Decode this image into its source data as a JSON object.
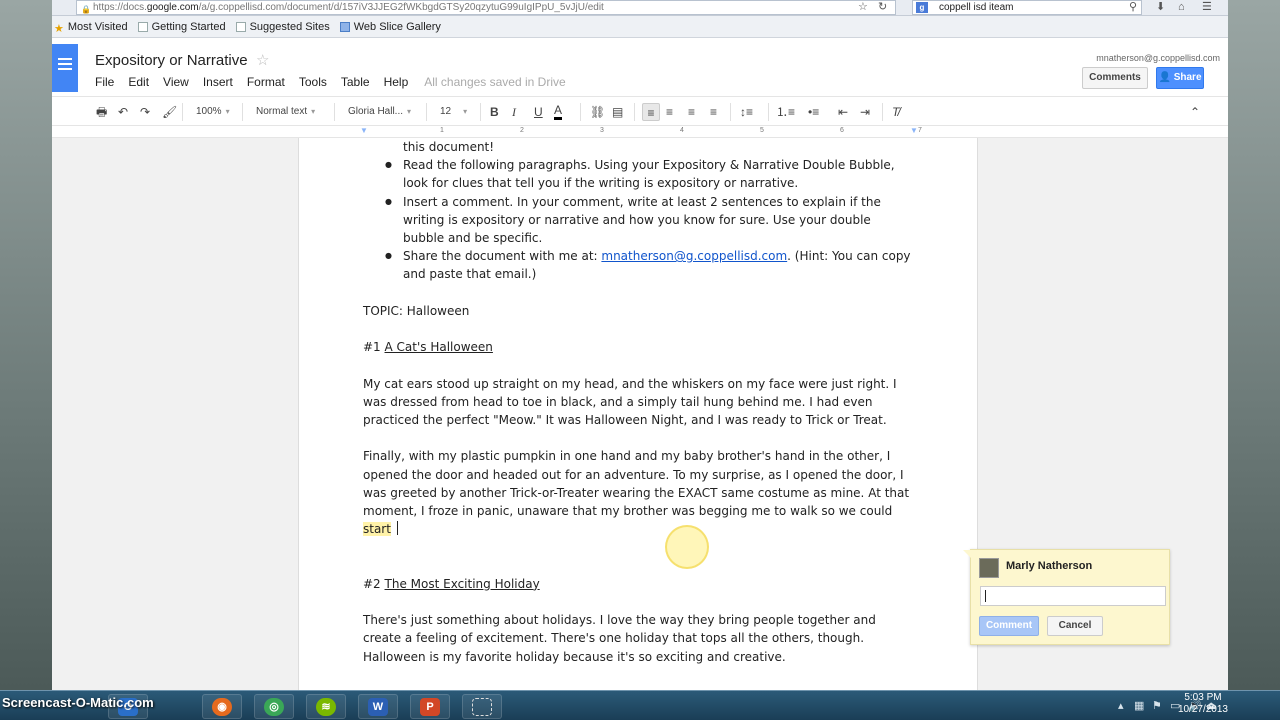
{
  "browser": {
    "url_prefix": "https://docs.",
    "url_domain": "google.com",
    "url_rest": "/a/g.coppellisd.com/document/d/157iV3JJEG2fWKbgdGTSy20qzytuG99uIgIPpU_5vJjU/edit",
    "search_query": "coppell isd iteam",
    "bookmarks": [
      "Most Visited",
      "Getting Started",
      "Suggested Sites",
      "Web Slice Gallery"
    ]
  },
  "docs": {
    "title": "Expository or Narrative",
    "menu": [
      "File",
      "Edit",
      "View",
      "Insert",
      "Format",
      "Tools",
      "Table",
      "Help"
    ],
    "saved_status": "All changes saved in Drive",
    "user_email": "mnatherson@g.coppellisd.com",
    "comments_label": "Comments",
    "share_label": "Share"
  },
  "toolbar": {
    "zoom": "100%",
    "style": "Normal text",
    "font": "Gloria Hall...",
    "size": "12"
  },
  "ruler": [
    "1",
    "2",
    "3",
    "4",
    "5",
    "6",
    "7"
  ],
  "document": {
    "cut_line": "this document!",
    "bullets": [
      "Read the following paragraphs. Using your Expository & Narrative Double Bubble, look for clues that tell you if the writing is expository or narrative.",
      "Insert a comment. In your comment, write at least 2 sentences to explain if the writing is expository or narrative and how you know for sure. Use your double bubble and be specific."
    ],
    "share_prefix": "Share the document with me at: ",
    "share_email": "mnatherson@g.coppellisd.com",
    "share_suffix": ". (Hint: You can copy and paste that email.)",
    "topic": "TOPIC: Halloween",
    "story1_num": "#1 ",
    "story1_title": "A Cat's Halloween",
    "para1": "My cat ears stood up straight on my head, and the whiskers on my face were just right. I was dressed from head to toe in black, and a simply tail hung behind me. I had even practiced the perfect \"Meow.\" It was Halloween Night, and I was ready to Trick or Treat.",
    "para2_main": "Finally, with my plastic pumpkin in one hand and my baby brother's hand in the other, I opened the door and headed out for an adventure. To my surprise, as I opened the door, I was greeted by another Trick-or-Treater wearing the EXACT same costume as mine. At that moment, I froze in panic, unaware that my brother was begging me to walk so we could ",
    "para2_highlight": "start",
    "story2_num": "#2 ",
    "story2_title": "The Most Exciting Holiday",
    "para3": "There's just something about holidays. I love the way they bring people together and create a feeling of excitement. There's one holiday that tops all the others, though. Halloween is my favorite holiday because it's so exciting and creative."
  },
  "comment": {
    "author": "Marly Natherson",
    "comment_label": "Comment",
    "cancel_label": "Cancel"
  },
  "taskbar": {
    "watermark": "Screencast-O-Matic.com",
    "time": "5:03 PM",
    "date": "10/27/2013"
  },
  "colors": {
    "accent": "#4285f4",
    "share": "#4d90fe",
    "highlight": "#fff2a8",
    "comment_bg": "#fdf7cf"
  }
}
